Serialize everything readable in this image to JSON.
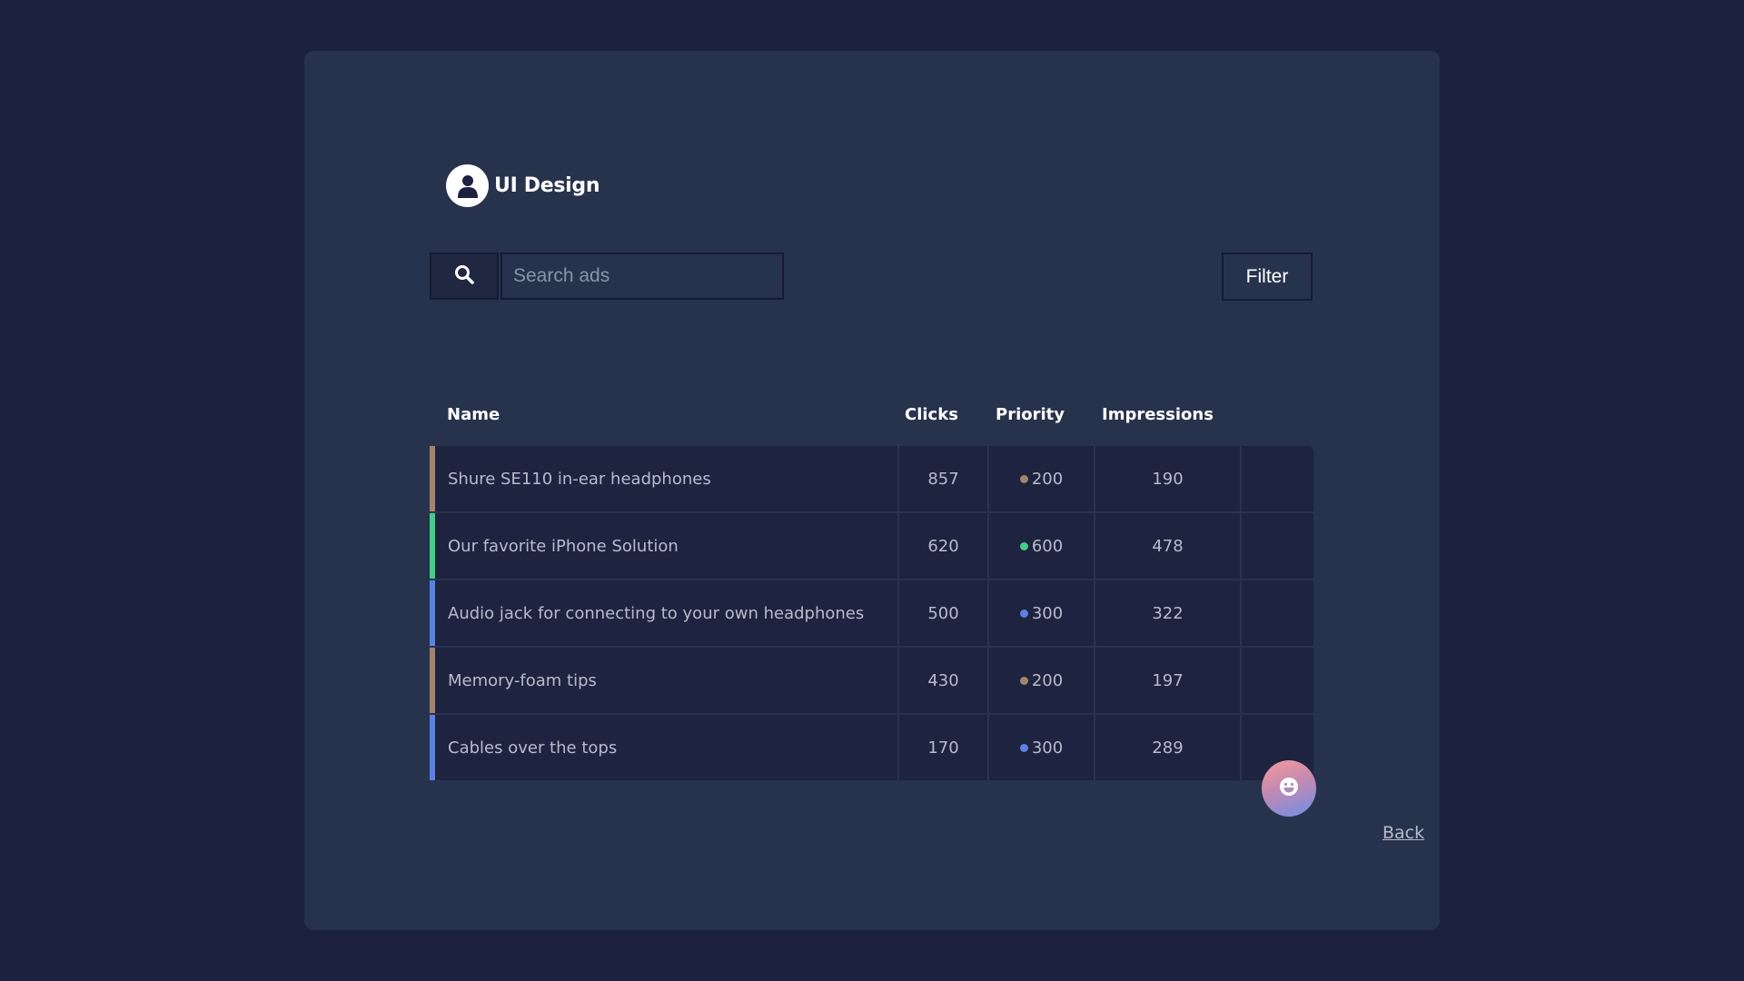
{
  "brand": {
    "title": "UI Design",
    "icon": "user-icon"
  },
  "search": {
    "icon": "search-icon",
    "placeholder": "Search ads",
    "value": ""
  },
  "filter_label": "Filter",
  "table": {
    "headers": {
      "name": "Name",
      "clicks": "Clicks",
      "priority": "Priority",
      "impressions": "Impressions"
    },
    "rows": [
      {
        "name": "Shure SE110 in-ear headphones",
        "clicks": "857",
        "priority": "200",
        "impressions": "190",
        "color": "#a3846b"
      },
      {
        "name": "Our favorite iPhone Solution",
        "clicks": "620",
        "priority": "600",
        "impressions": "478",
        "color": "#3fcf87"
      },
      {
        "name": "Audio jack for connecting to your own headphones",
        "clicks": "500",
        "priority": "300",
        "impressions": "322",
        "color": "#5b82e0"
      },
      {
        "name": "Memory-foam tips",
        "clicks": "430",
        "priority": "200",
        "impressions": "197",
        "color": "#a3846b"
      },
      {
        "name": "Cables over the tops",
        "clicks": "170",
        "priority": "300",
        "impressions": "289",
        "color": "#5b82e0"
      }
    ]
  },
  "fab": {
    "icon": "smiley-icon"
  },
  "back_label": "Back"
}
